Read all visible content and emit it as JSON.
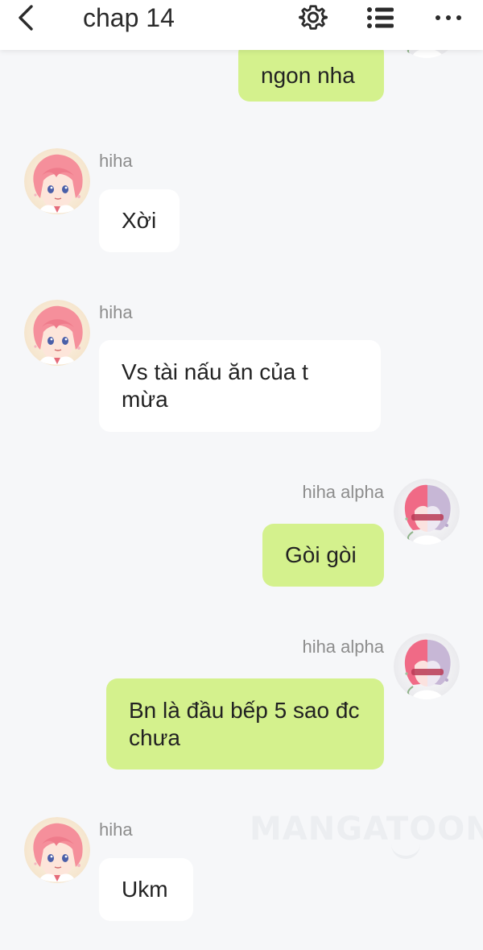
{
  "header": {
    "title": "chap 14",
    "back_icon": "chevron-left-icon",
    "settings_icon": "gear-icon",
    "menu_icon": "list-icon",
    "more_icon": "more-horizontal-icon"
  },
  "colors": {
    "background": "#f6f7f9",
    "own_bubble": "#d4f18d",
    "other_bubble": "#ffffff",
    "name_text": "#8d8d8d"
  },
  "messages": [
    {
      "sender": "",
      "text": "ngon nha",
      "side": "right"
    },
    {
      "sender": "hiha",
      "text": "Xời",
      "side": "left"
    },
    {
      "sender": "hiha",
      "text": "Vs tài nấu ăn của t mừa",
      "side": "left"
    },
    {
      "sender": "hiha alpha",
      "text": "Gòi gòi",
      "side": "right"
    },
    {
      "sender": "hiha alpha",
      "text": "Bn là đầu bếp 5 sao đc chưa",
      "side": "right"
    },
    {
      "sender": "hiha",
      "text": "Ukm",
      "side": "left"
    }
  ],
  "watermark": "MANGATOON"
}
